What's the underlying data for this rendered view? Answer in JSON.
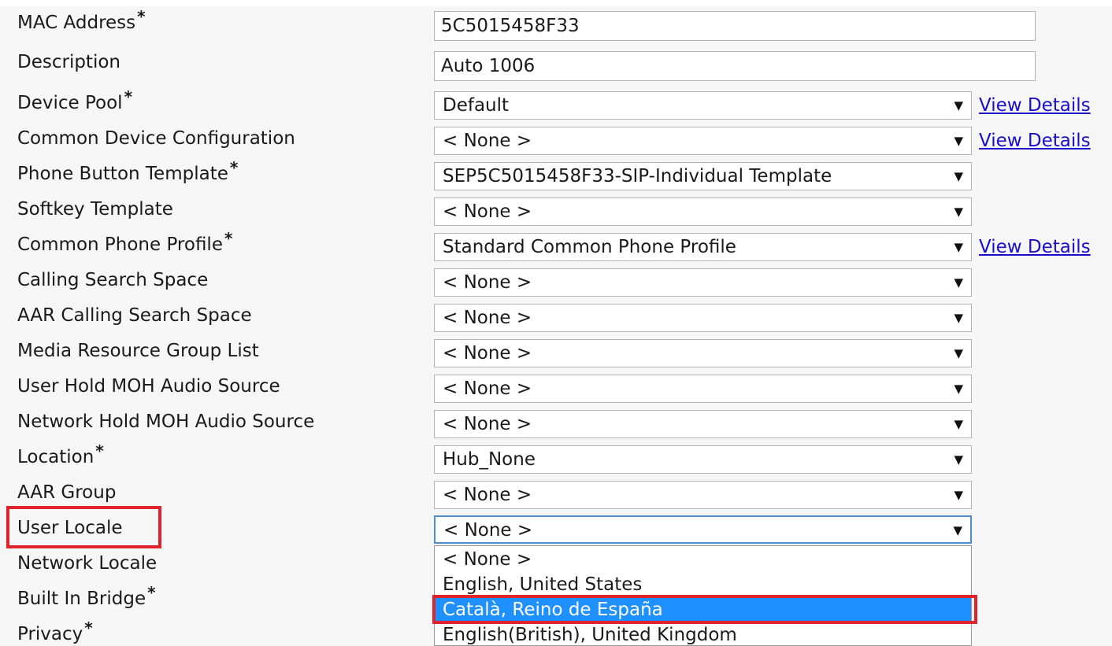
{
  "fields": [
    {
      "label": "MAC Address",
      "required": true,
      "type": "text",
      "value": "5C5015458F33"
    },
    {
      "label": "Description",
      "required": false,
      "type": "text",
      "value": "Auto 1006"
    },
    {
      "label": "Device Pool",
      "required": true,
      "type": "select",
      "value": "Default",
      "link": "View Details"
    },
    {
      "label": "Common Device Configuration",
      "required": false,
      "type": "select",
      "value": "< None >",
      "link": "View Details"
    },
    {
      "label": "Phone Button Template",
      "required": true,
      "type": "select",
      "value": "SEP5C5015458F33-SIP-Individual Template"
    },
    {
      "label": "Softkey Template",
      "required": false,
      "type": "select",
      "value": "< None >"
    },
    {
      "label": "Common Phone Profile",
      "required": true,
      "type": "select",
      "value": "Standard Common Phone Profile",
      "link": "View Details"
    },
    {
      "label": "Calling Search Space",
      "required": false,
      "type": "select",
      "value": "< None >"
    },
    {
      "label": "AAR Calling Search Space",
      "required": false,
      "type": "select",
      "value": "< None >"
    },
    {
      "label": "Media Resource Group List",
      "required": false,
      "type": "select",
      "value": "< None >"
    },
    {
      "label": "User Hold MOH Audio Source",
      "required": false,
      "type": "select",
      "value": "< None >"
    },
    {
      "label": "Network Hold MOH Audio Source",
      "required": false,
      "type": "select",
      "value": "< None >"
    },
    {
      "label": "Location",
      "required": true,
      "type": "select",
      "value": "Hub_None"
    },
    {
      "label": "AAR Group",
      "required": false,
      "type": "select",
      "value": "< None >"
    },
    {
      "label": "User Locale",
      "required": false,
      "type": "select",
      "value": "< None >"
    },
    {
      "label": "Network Locale",
      "required": false
    },
    {
      "label": "Built In Bridge",
      "required": true
    },
    {
      "label": "Privacy",
      "required": true
    }
  ],
  "required_marker": "*",
  "dropdown_arrow": "▼",
  "user_locale_options": [
    {
      "text": "< None >",
      "selected": false
    },
    {
      "text": "English, United States",
      "selected": false
    },
    {
      "text": "Català, Reino de España",
      "selected": true
    },
    {
      "text": "English(British), United Kingdom",
      "selected": false
    }
  ],
  "colors": {
    "highlight": "#e3232b",
    "selected_option": "#1e90ff",
    "link": "#1a0dcc",
    "focus_border": "#4a8fd3"
  }
}
